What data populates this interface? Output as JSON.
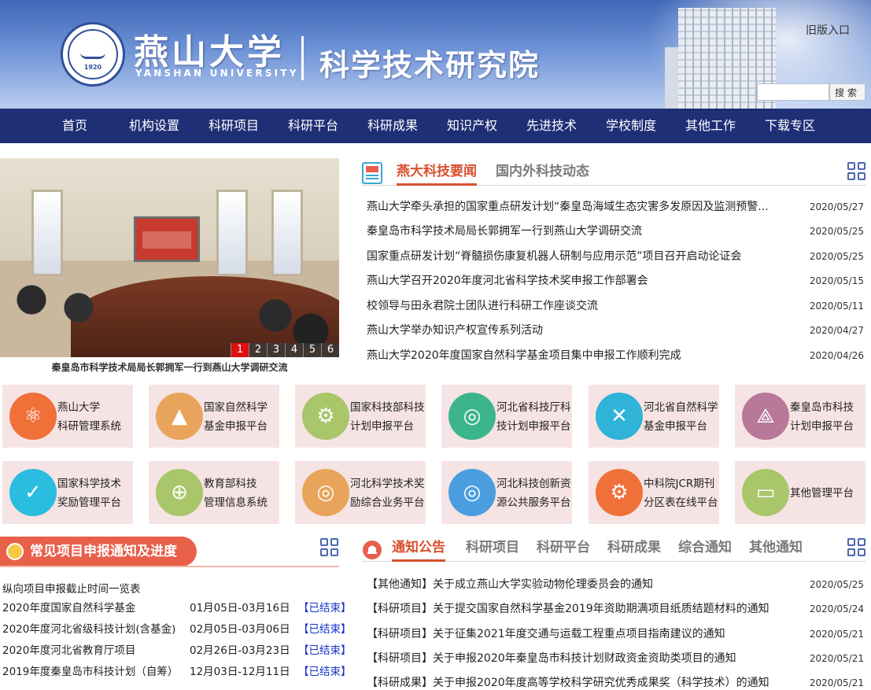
{
  "header": {
    "seal_year": "1920",
    "university_cn": "燕山大学",
    "university_en": "YANSHAN UNIVERSITY",
    "institute": "科学技术研究院",
    "old_entry": "旧版入口",
    "search_placeholder": "",
    "search_button": "搜索"
  },
  "nav": [
    "首页",
    "机构设置",
    "科研项目",
    "科研平台",
    "科研成果",
    "知识产权",
    "先进技术",
    "学校制度",
    "其他工作",
    "下载专区"
  ],
  "slider": {
    "caption": "秦皇岛市科学技术局局长郭拥军一行到燕山大学调研交流",
    "pages": [
      "1",
      "2",
      "3",
      "4",
      "5",
      "6"
    ],
    "active_page": 1
  },
  "news": {
    "tab_active": "燕大科技要闻",
    "tab_other": "国内外科技动态",
    "items": [
      {
        "title": "燕山大学牵头承担的国家重点研发计划“秦皇岛海域生态灾害多发原因及监测预警...",
        "date": "2020/05/27"
      },
      {
        "title": "秦皇岛市科学技术局局长郭拥军一行到燕山大学调研交流",
        "date": "2020/05/25"
      },
      {
        "title": "国家重点研发计划“脊髓损伤康复机器人研制与应用示范”项目召开启动论证会",
        "date": "2020/05/25"
      },
      {
        "title": "燕山大学召开2020年度河北省科学技术奖申报工作部署会",
        "date": "2020/05/15"
      },
      {
        "title": "校领导与田永君院士团队进行科研工作座谈交流",
        "date": "2020/05/11"
      },
      {
        "title": "燕山大学举办知识产权宣传系列活动",
        "date": "2020/04/27"
      },
      {
        "title": "燕山大学2020年度国家自然科学基金项目集中申报工作顺利完成",
        "date": "2020/04/26"
      }
    ]
  },
  "platforms": [
    {
      "label": "燕山大学\n科研管理系统",
      "color": "#f0703a",
      "icon": "atom-icon"
    },
    {
      "label": "国家自然科学\n基金申报平台",
      "color": "#e8a45a",
      "icon": "nsfc-icon"
    },
    {
      "label": "国家科技部科技\n计划申报平台",
      "color": "#a9c66a",
      "icon": "gear-doc-icon"
    },
    {
      "label": "河北省科技厅科\n技计划申报平台",
      "color": "#3cb48e",
      "icon": "globe-icon"
    },
    {
      "label": "河北省自然科学\n基金申报平台",
      "color": "#2fb3d8",
      "icon": "tools-icon"
    },
    {
      "label": "秦皇岛市科技\n计划申报平台",
      "color": "#b8789a",
      "icon": "share-icon"
    },
    {
      "label": "国家科学技术\n奖励管理平台",
      "color": "#2bbde0",
      "icon": "award-icon"
    },
    {
      "label": "教育部科技\n管理信息系统",
      "color": "#a9c66a",
      "icon": "compass-icon"
    },
    {
      "label": "河北科学技术奖\n励综合业务平台",
      "color": "#e8a45a",
      "icon": "globe-icon"
    },
    {
      "label": "河北科技创新资\n源公共服务平台",
      "color": "#4a9ee0",
      "icon": "globe-icon"
    },
    {
      "label": "中科院JCR期刊\n分区表在线平台",
      "color": "#f0703a",
      "icon": "cog-icon"
    },
    {
      "label": "其他管理平台",
      "color": "#a9c66a",
      "icon": "window-icon"
    }
  ],
  "projects": {
    "title": "常见项目申报通知及进度",
    "subtitle": "纵向项目申报截止时间一览表",
    "rows": [
      {
        "name": "2020年度国家自然科学基金",
        "period": "01月05日-03月16日",
        "status": "【已结束】"
      },
      {
        "name": "2020年度河北省级科技计划(含基金)",
        "period": "02月05日-03月06日",
        "status": "【已结束】"
      },
      {
        "name": "2020年度河北省教育厅项目",
        "period": "02月26日-03月23日",
        "status": "【已结束】"
      },
      {
        "name": "2019年度秦皇岛市科技计划（自筹）",
        "period": "12月03日-12月11日",
        "status": "【已结束】"
      }
    ]
  },
  "notices": {
    "tabs": [
      "通知公告",
      "科研项目",
      "科研平台",
      "科研成果",
      "综合通知",
      "其他通知"
    ],
    "items": [
      {
        "title": "【其他通知】关于成立燕山大学实验动物伦理委员会的通知",
        "date": "2020/05/25"
      },
      {
        "title": "【科研项目】关于提交国家自然科学基金2019年资助期满项目纸质结题材料的通知",
        "date": "2020/05/24"
      },
      {
        "title": "【科研项目】关于征集2021年度交通与运载工程重点项目指南建议的通知",
        "date": "2020/05/21"
      },
      {
        "title": "【科研项目】关于申报2020年秦皇岛市科技计划财政资金资助类项目的通知",
        "date": "2020/05/21"
      },
      {
        "title": "【科研成果】关于申报2020年度高等学校科学研究优秀成果奖（科学技术）的通知",
        "date": "2020/05/21"
      }
    ]
  },
  "colors": {
    "nav_bg": "#1f2f76",
    "accent": "#d8502e",
    "status": "#1733c9",
    "tile_bg": "#f6e3e3"
  }
}
